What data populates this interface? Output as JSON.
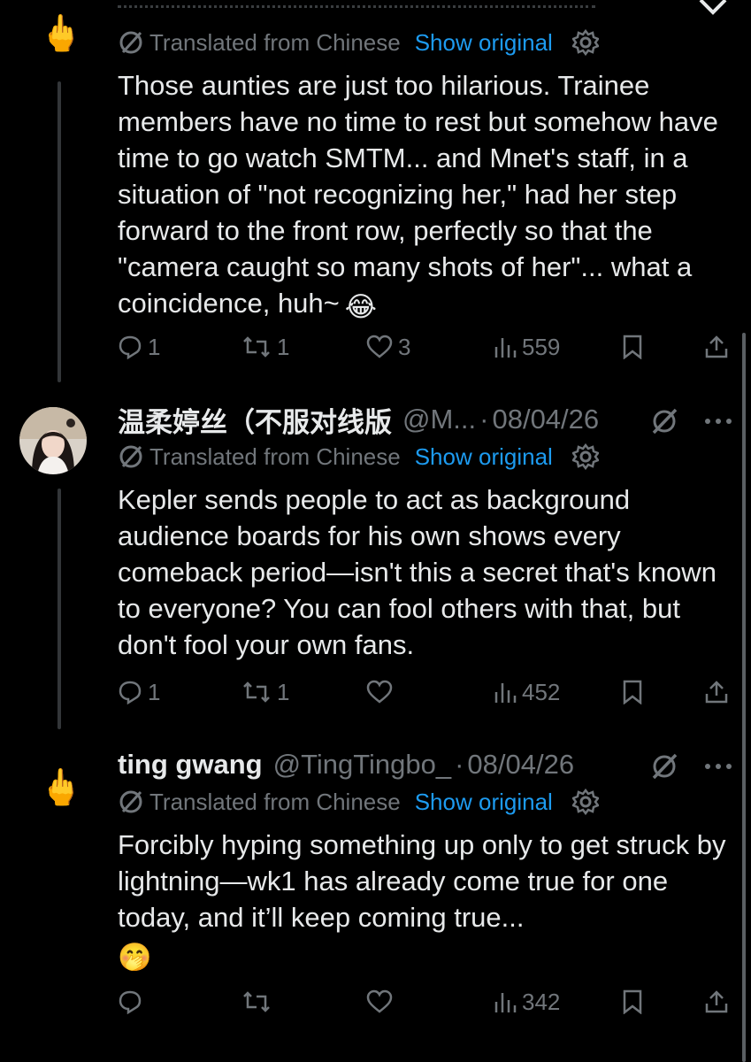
{
  "tweets": [
    {
      "translated_label": "Translated from Chinese",
      "show_original": "Show original",
      "text": "Those aunties are just too hilarious. Trainee members have no time to rest but somehow have time to go watch SMTM... and Mnet's staff, in a situation of \"not recognizing her,\" had her step forward to the front row, perfectly so that the \"camera caught so many shots of her\"... what a coincidence, huh~",
      "emoji": "😂",
      "replies": "1",
      "reposts": "1",
      "likes": "3",
      "views": "559"
    },
    {
      "name": "温柔婷丝（不服对线版",
      "handle": "@M...",
      "separator": "·",
      "date": "08/04/26",
      "translated_label": "Translated from Chinese",
      "show_original": "Show original",
      "text": "Kepler sends people to act as background audience boards for his own shows every comeback period—isn't this a secret that's known to everyone? You can fool others with that, but don't fool your own fans.",
      "replies": "1",
      "reposts": "1",
      "likes": "",
      "views": "452"
    },
    {
      "name": "ting gwang",
      "handle": "@TingTingbo_",
      "separator": "·",
      "date": "08/04/26",
      "translated_label": "Translated from Chinese",
      "show_original": "Show original",
      "text": "Forcibly hyping something up only to get struck by lightning—wk1 has already come true for one today, and it’ll keep coming true...",
      "emoji": "🤭",
      "replies": "",
      "reposts": "",
      "likes": "",
      "views": "342"
    }
  ],
  "colors": {
    "background": "#000000",
    "text": "#e7e9ea",
    "muted": "#71767b",
    "link": "#1d9bf0",
    "thread_line": "#333639"
  },
  "icons": [
    "middle-finger-icon",
    "grok-icon",
    "more-icon",
    "translate-icon",
    "settings-icon",
    "reply-icon",
    "repost-icon",
    "like-icon",
    "views-icon",
    "bookmark-icon",
    "share-icon",
    "close-icon"
  ]
}
